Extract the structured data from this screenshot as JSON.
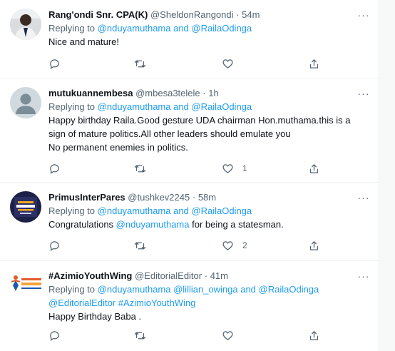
{
  "tweets": [
    {
      "name": "Rang'ondi Snr. CPA(K)",
      "handle": "@SheldonRangondi",
      "time": "54m",
      "replying_prefix": "Replying to",
      "replying_to": "@nduyamuthama and @RailaOdinga",
      "text": "Nice and mature!",
      "likes": ""
    },
    {
      "name": "mutukuannembesa",
      "handle": "@mbesa3telele",
      "time": "1h",
      "replying_prefix": "Replying to",
      "replying_to": "@nduyamuthama and @RailaOdinga",
      "text_line1": "Happy birthday Raila.Good gesture UDA chairman Hon.muthama.this is a",
      "text_line2": "sign of mature politics.All other leaders should emulate you",
      "text_line3": "No permanent enemies in politics.",
      "likes": "1"
    },
    {
      "name": "PrimusInterPares",
      "handle": "@tushkev2245",
      "time": "58m",
      "replying_prefix": "Replying to",
      "replying_to": "@nduyamuthama and @RailaOdinga",
      "text_pre": "Congratulations ",
      "text_mention": "@nduyamuthama",
      "text_post": " for being a statesman.",
      "likes": "2"
    },
    {
      "name": "#AzimioYouthWing",
      "handle": "@EditorialEditor",
      "time": "41m",
      "replying_prefix": "Replying to",
      "replying_to_line1": "@nduyamuthama @lillian_owinga and @RailaOdinga",
      "replying_to_line2": "@EditorialEditor #AzimioYouthWing",
      "text": "Happy Birthday Baba .",
      "likes": ""
    }
  ],
  "colors": {
    "link": "#1d9bf0",
    "muted": "#536471",
    "text": "#0f1419",
    "divider": "#eff3f4"
  },
  "icons": [
    "reply-icon",
    "retweet-icon",
    "like-icon",
    "share-icon",
    "more-icon"
  ]
}
